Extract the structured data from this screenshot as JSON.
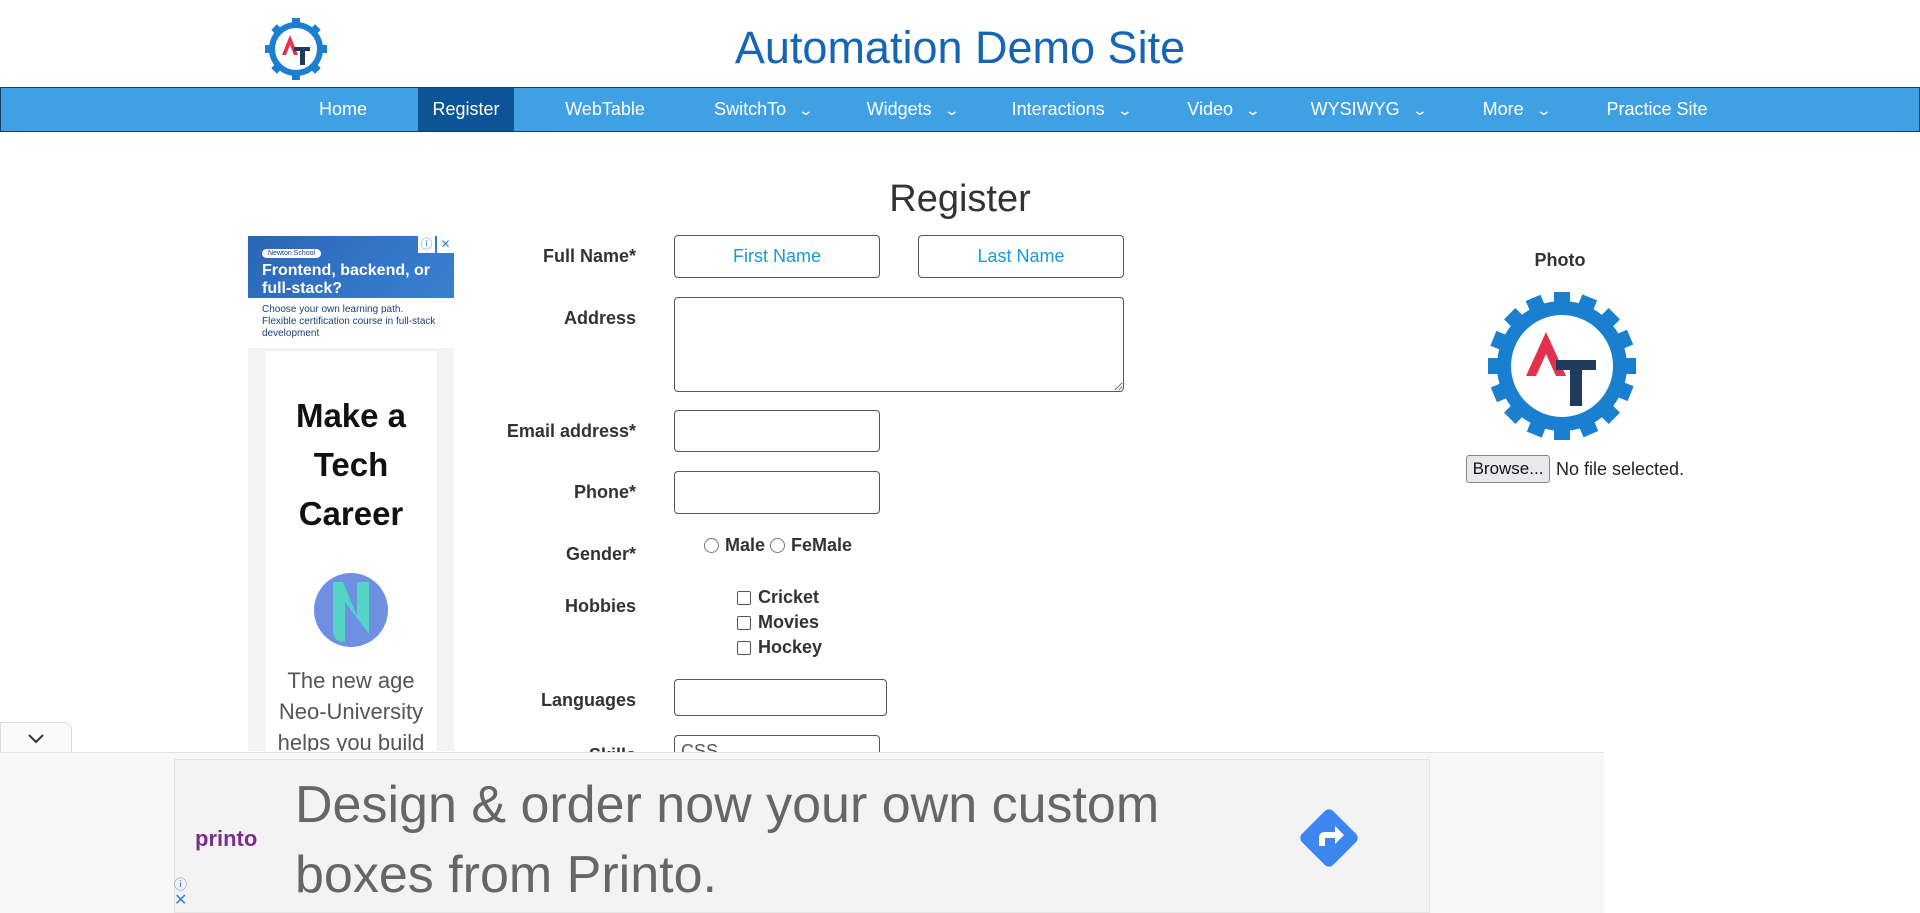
{
  "header": {
    "title": "Automation Demo Site"
  },
  "nav": {
    "items": [
      {
        "label": "Home"
      },
      {
        "label": "Register"
      },
      {
        "label": "WebTable"
      },
      {
        "label": "SwitchTo"
      },
      {
        "label": "Widgets"
      },
      {
        "label": "Interactions"
      },
      {
        "label": "Video"
      },
      {
        "label": "WYSIWYG"
      },
      {
        "label": "More"
      },
      {
        "label": "Practice Site"
      }
    ],
    "active": "Register"
  },
  "page": {
    "heading": "Register"
  },
  "form": {
    "full_name_label": "Full Name*",
    "first_name_placeholder": "First Name",
    "last_name_placeholder": "Last Name",
    "address_label": "Address",
    "email_label": "Email address*",
    "phone_label": "Phone*",
    "gender_label": "Gender*",
    "gender_options": [
      "Male",
      "FeMale"
    ],
    "hobbies_label": "Hobbies",
    "hobbies": [
      "Cricket",
      "Movies",
      "Hockey"
    ],
    "languages_label": "Languages",
    "skills_label": "Skills",
    "skills_value": "CSS"
  },
  "photo": {
    "label": "Photo",
    "browse_label": "Browse...",
    "status": "No file selected."
  },
  "left_ad": {
    "brand": "Newton School",
    "headline": "Frontend, backend, or full-stack?",
    "sub": "Choose your own learning path. Flexible certification course in full-stack development",
    "card_title": "Make a Tech Career",
    "card_body": "The new age Neo-University helps you build"
  },
  "bottom_ad": {
    "brand": "printo",
    "text": "Design & order now your own custom boxes from Printo."
  },
  "colors": {
    "nav_bg": "#3fa1e3",
    "nav_active": "#0c5496",
    "title": "#1565b4",
    "placeholder": "#1a9ad6"
  }
}
